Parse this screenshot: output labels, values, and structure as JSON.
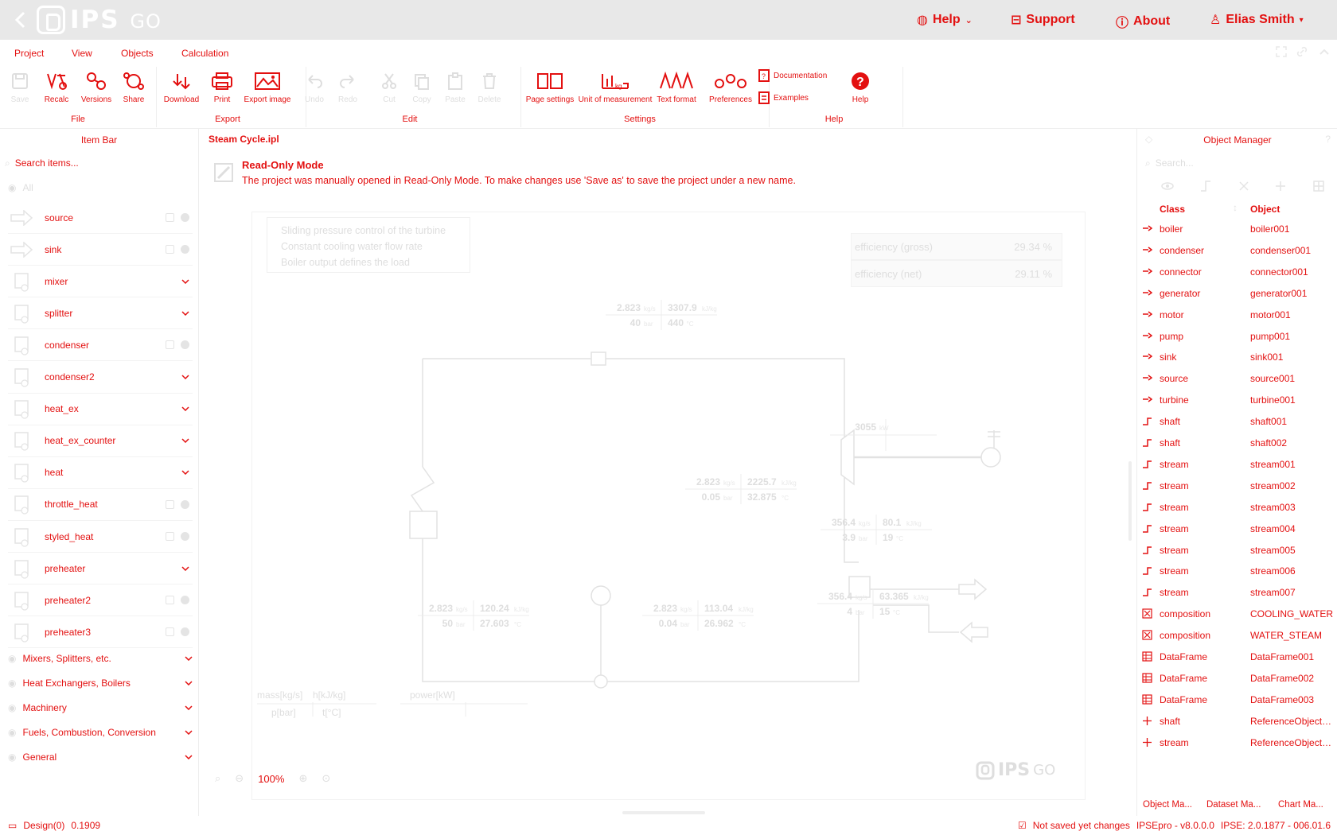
{
  "topbar": {
    "logo_text": "IPS",
    "logo_suffix": "GO",
    "help_label": "Help",
    "support_label": "Support",
    "about_label": "About",
    "user_label": "Elias Smith"
  },
  "menu": [
    "Project",
    "View",
    "Objects",
    "Calculation"
  ],
  "ribbon": {
    "buttons": [
      {
        "label": "Save",
        "icon": "save-icon",
        "faint": true
      },
      {
        "label": "Recalc",
        "icon": "recalc-icon",
        "faint": false
      },
      {
        "label": "Versions",
        "icon": "versions-icon",
        "faint": false
      },
      {
        "label": "Share",
        "icon": "share-icon",
        "faint": false
      },
      {
        "label": "Download",
        "icon": "download-icon",
        "faint": false
      },
      {
        "label": "Print",
        "icon": "print-icon",
        "faint": false
      },
      {
        "label": "Export image",
        "icon": "export-image-icon",
        "faint": false
      },
      {
        "label": "Undo",
        "icon": "undo-icon",
        "faint": true
      },
      {
        "label": "Redo",
        "icon": "redo-icon",
        "faint": true
      },
      {
        "label": "Cut",
        "icon": "cut-icon",
        "faint": true
      },
      {
        "label": "Copy",
        "icon": "copy-icon",
        "faint": true
      },
      {
        "label": "Paste",
        "icon": "paste-icon",
        "faint": true
      },
      {
        "label": "Delete",
        "icon": "delete-icon",
        "faint": true
      },
      {
        "label": "Page settings",
        "icon": "page-settings-icon",
        "faint": false
      },
      {
        "label": "Unit of measurement",
        "icon": "units-icon",
        "faint": false
      },
      {
        "label": "Text format",
        "icon": "text-format-icon",
        "faint": false
      },
      {
        "label": "Preferences",
        "icon": "preferences-icon",
        "faint": false
      },
      {
        "label": "Documentation",
        "icon": "documentation-icon",
        "faint": false
      },
      {
        "label": "Examples",
        "icon": "examples-icon",
        "faint": false
      },
      {
        "label": "Help",
        "icon": "help-circle-icon",
        "faint": false
      }
    ],
    "groups": [
      "File",
      "Export",
      "Edit",
      "Settings",
      "Help"
    ]
  },
  "left_panel": {
    "title": "Item Bar",
    "search_placeholder": "Search items...",
    "all_label": "All",
    "components": [
      {
        "label": "source",
        "icon": "source-arrow-icon",
        "kind": "link"
      },
      {
        "label": "sink",
        "icon": "sink-arrow-icon",
        "kind": "link"
      },
      {
        "label": "mixer",
        "icon": "mixer-icon",
        "kind": "expand"
      },
      {
        "label": "splitter",
        "icon": "splitter-icon",
        "kind": "expand"
      },
      {
        "label": "condenser",
        "icon": "condenser-icon",
        "kind": "link"
      },
      {
        "label": "condenser2",
        "icon": "condenser2-icon",
        "kind": "expand"
      },
      {
        "label": "heat_ex",
        "icon": "heat-exchanger-icon",
        "kind": "expand"
      },
      {
        "label": "heat_ex_counter",
        "icon": "heat-exchanger-counter-icon",
        "kind": "expand"
      },
      {
        "label": "heat",
        "icon": "heat-icon",
        "kind": "expand"
      },
      {
        "label": "throttle_heat",
        "icon": "throttle-heat-icon",
        "kind": "link"
      },
      {
        "label": "styled_heat",
        "icon": "styled-heat-icon",
        "kind": "link"
      },
      {
        "label": "preheater",
        "icon": "preheater-icon",
        "kind": "expand"
      },
      {
        "label": "preheater2",
        "icon": "preheater2-icon",
        "kind": "link"
      },
      {
        "label": "preheater3",
        "icon": "preheater3-icon",
        "kind": "link"
      }
    ],
    "groups": [
      "Mixers, Splitters, etc.",
      "Heat Exchangers, Boilers",
      "Machinery",
      "Fuels, Combustion, Conversion",
      "General"
    ]
  },
  "center": {
    "breadcrumb": "Steam Cycle.ipl",
    "readonly_title": "Read-Only Mode",
    "readonly_message": "The project was manually opened in Read-Only Mode. To make changes use 'Save as' to save the project under a new name.",
    "notes": [
      "Sliding pressure control of the turbine",
      "Constant cooling water flow rate",
      "Boiler output defines the load"
    ],
    "efficiency": [
      {
        "label": "efficiency (gross)",
        "value": "29.34",
        "unit": "%"
      },
      {
        "label": "efficiency (net)",
        "value": "29.11",
        "unit": "%"
      }
    ],
    "stream_labels": [
      {
        "m": "2.823",
        "h": "3307.9",
        "p": "40",
        "t": "440"
      },
      {
        "m": "2.823",
        "h": "2225.7",
        "p": "0.05",
        "t": "32.875"
      },
      {
        "m": "356.4",
        "h": "80.1",
        "p": "3.9",
        "t": "19"
      },
      {
        "m": "356.4",
        "h": "63.365",
        "p": "4",
        "t": "15"
      },
      {
        "m": "2.823",
        "h": "120.24",
        "p": "50",
        "t": "27.603"
      },
      {
        "m": "2.823",
        "h": "113.04",
        "p": "0.04",
        "t": "26.962"
      }
    ],
    "power_label": "3055",
    "units": {
      "m": "kg/s",
      "h": "kJ/kg",
      "p": "bar",
      "t": "°C",
      "power": "kW"
    },
    "legend": {
      "mass": "mass[kg/s]",
      "enthalpy": "h[kJ/kg]",
      "power": "power[kW]",
      "pressure": "p[bar]",
      "temperature": "t[°C]"
    },
    "zoom": "100%",
    "watermark_text": "IPS",
    "watermark_suffix": "GO"
  },
  "right_panel": {
    "title": "Object Manager",
    "search_placeholder": "Search...",
    "col_class": "Class",
    "col_object": "Object",
    "rows": [
      {
        "cls": "boiler",
        "obj": "boiler001",
        "icon": "component-icon"
      },
      {
        "cls": "condenser",
        "obj": "condenser001",
        "icon": "component-icon"
      },
      {
        "cls": "connector",
        "obj": "connector001",
        "icon": "component-icon"
      },
      {
        "cls": "generator",
        "obj": "generator001",
        "icon": "component-icon"
      },
      {
        "cls": "motor",
        "obj": "motor001",
        "icon": "component-icon"
      },
      {
        "cls": "pump",
        "obj": "pump001",
        "icon": "component-icon"
      },
      {
        "cls": "sink",
        "obj": "sink001",
        "icon": "component-icon"
      },
      {
        "cls": "source",
        "obj": "source001",
        "icon": "component-icon"
      },
      {
        "cls": "turbine",
        "obj": "turbine001",
        "icon": "component-icon"
      },
      {
        "cls": "shaft",
        "obj": "shaft001",
        "icon": "connection-icon"
      },
      {
        "cls": "shaft",
        "obj": "shaft002",
        "icon": "connection-icon"
      },
      {
        "cls": "stream",
        "obj": "stream001",
        "icon": "connection-icon"
      },
      {
        "cls": "stream",
        "obj": "stream002",
        "icon": "connection-icon"
      },
      {
        "cls": "stream",
        "obj": "stream003",
        "icon": "connection-icon"
      },
      {
        "cls": "stream",
        "obj": "stream004",
        "icon": "connection-icon"
      },
      {
        "cls": "stream",
        "obj": "stream005",
        "icon": "connection-icon"
      },
      {
        "cls": "stream",
        "obj": "stream006",
        "icon": "connection-icon"
      },
      {
        "cls": "stream",
        "obj": "stream007",
        "icon": "connection-icon"
      },
      {
        "cls": "composition",
        "obj": "COOLING_WATER",
        "icon": "composition-icon"
      },
      {
        "cls": "composition",
        "obj": "WATER_STEAM",
        "icon": "composition-icon"
      },
      {
        "cls": "DataFrame",
        "obj": "DataFrame001",
        "icon": "dataframe-icon"
      },
      {
        "cls": "DataFrame",
        "obj": "DataFrame002",
        "icon": "dataframe-icon"
      },
      {
        "cls": "DataFrame",
        "obj": "DataFrame003",
        "icon": "dataframe-icon"
      },
      {
        "cls": "shaft",
        "obj": "ReferenceObjectShaft",
        "icon": "reference-icon"
      },
      {
        "cls": "stream",
        "obj": "ReferenceObjectStream",
        "icon": "reference-icon"
      }
    ],
    "tabs": [
      "Object Ma...",
      "Dataset Ma...",
      "Chart Ma..."
    ]
  },
  "status": {
    "mode": "Design(0)",
    "time": "0.1909",
    "saved": "Not saved yet changes",
    "version": "IPSEpro - v8.0.0.0",
    "version_full": "IPSE: 2.0.1877 - 006.01.6"
  },
  "colors": {
    "accent": "#e31010",
    "faint": "#dedede",
    "topbar": "#e8e8e8"
  }
}
